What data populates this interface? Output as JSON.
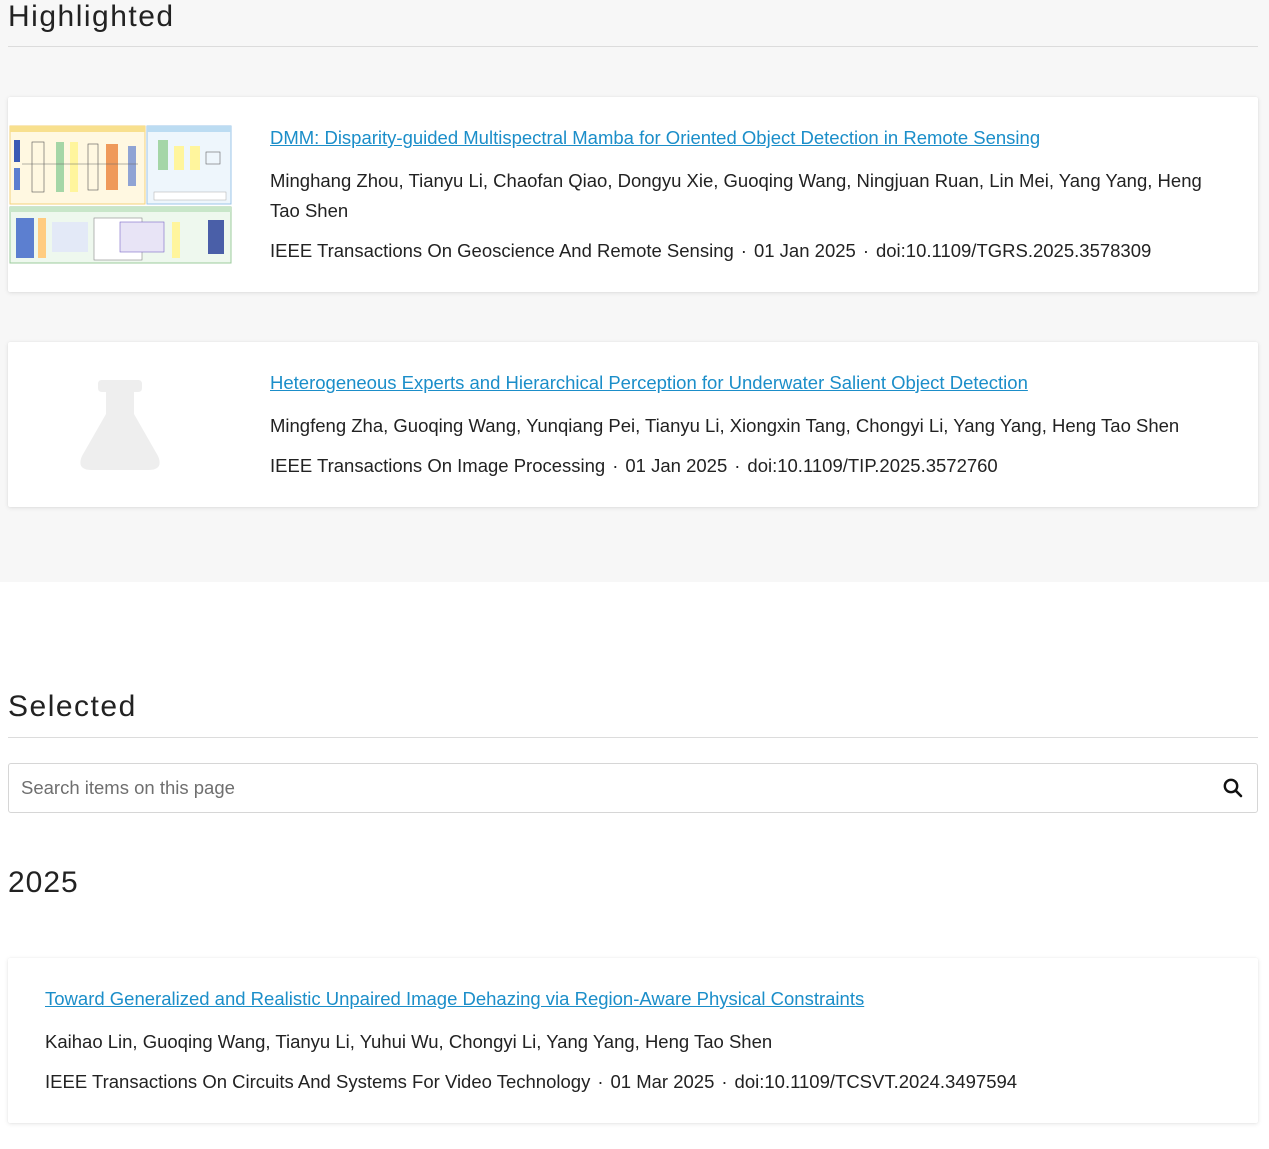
{
  "highlighted": {
    "heading": "Highlighted",
    "items": [
      {
        "title": "DMM: Disparity-guided Multispectral Mamba for Oriented Object Detection in Remote Sensing",
        "authors": "Minghang Zhou, Tianyu Li, Chaofan Qiao, Dongyu Xie, Guoqing Wang, Ningjuan Ruan, Lin Mei, Yang Yang, Heng Tao Shen",
        "journal": "IEEE Transactions On Geoscience And Remote Sensing",
        "date": "01 Jan 2025",
        "doi": "doi:10.1109/TGRS.2025.3578309",
        "thumbnail": "architecture-diagram-thumbnail"
      },
      {
        "title": "Heterogeneous Experts and Hierarchical Perception for Underwater Salient Object Detection",
        "authors": "Mingfeng Zha, Guoqing Wang, Yunqiang Pei, Tianyu Li, Xiongxin Tang, Chongyi Li, Yang Yang, Heng Tao Shen",
        "journal": "IEEE Transactions On Image Processing",
        "date": "01 Jan 2025",
        "doi": "doi:10.1109/TIP.2025.3572760",
        "thumbnail": "flask-icon"
      }
    ]
  },
  "selected": {
    "heading": "Selected",
    "search_placeholder": "Search items on this page",
    "search_icon": "search-icon",
    "year": "2025",
    "items": [
      {
        "title": "Toward Generalized and Realistic Unpaired Image Dehazing via Region-Aware Physical Constraints",
        "authors": "Kaihao Lin, Guoqing Wang, Tianyu Li, Yuhui Wu, Chongyi Li, Yang Yang, Heng Tao Shen",
        "journal": "IEEE Transactions On Circuits And Systems For Video Technology",
        "date": "01 Mar 2025",
        "doi": "doi:10.1109/TCSVT.2024.3497594"
      }
    ]
  },
  "meta_separator": "·",
  "colors": {
    "link": "#1b8ec9",
    "band_background": "#f7f7f7",
    "placeholder_icon": "#eeeeee"
  }
}
